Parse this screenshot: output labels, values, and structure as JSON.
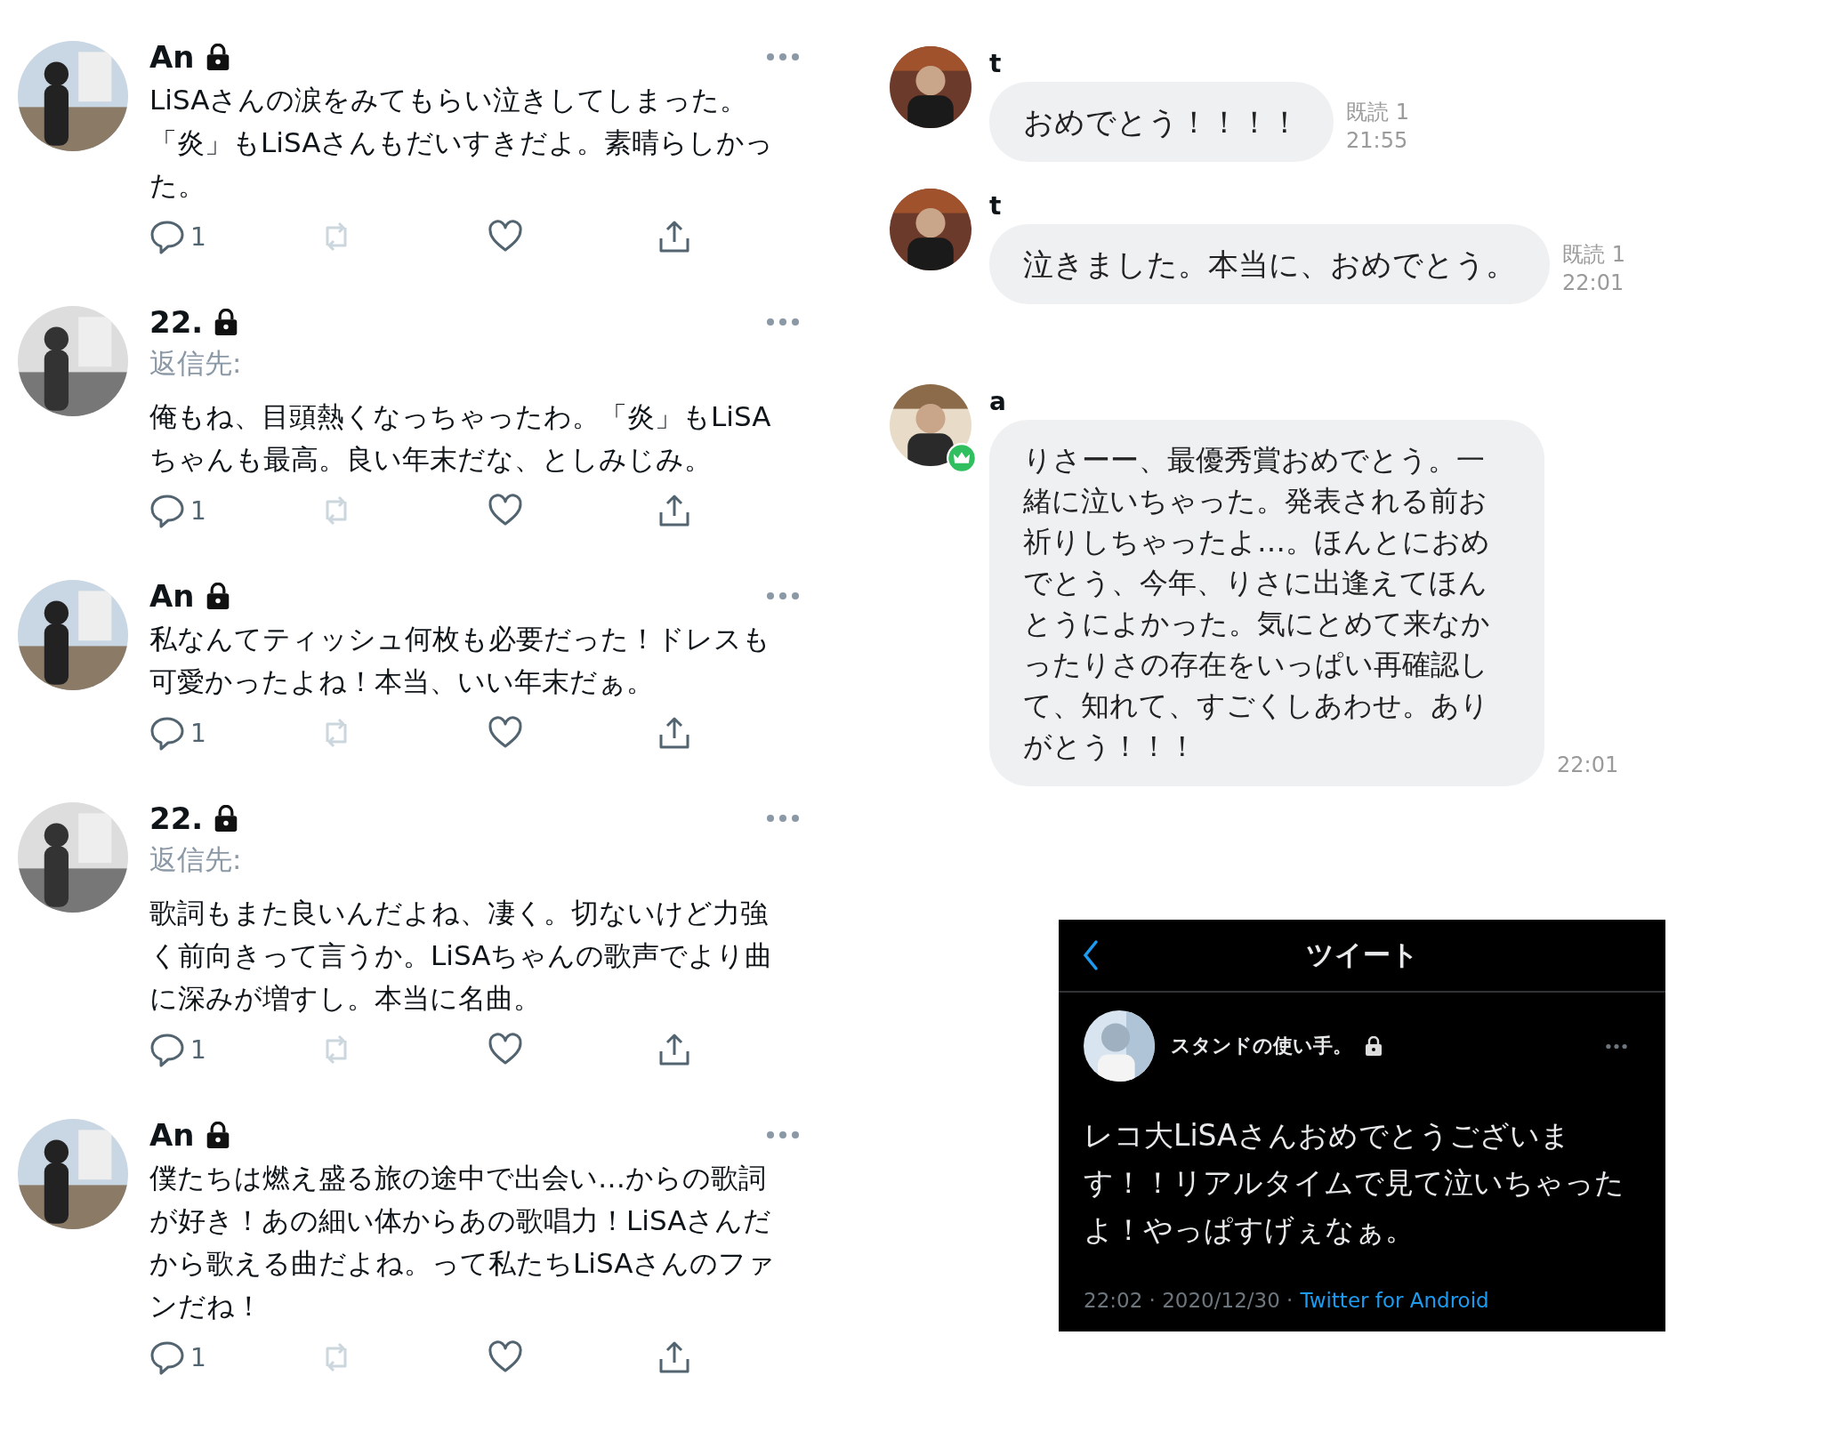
{
  "tweets": [
    {
      "name": "An",
      "protected": true,
      "text": "LiSAさんの涙をみてもらい泣きしてしまった。「炎」もLiSAさんもだいすきだよ。素晴らしかった。",
      "reply_count": "1"
    },
    {
      "name": "22.",
      "protected": true,
      "reply_to_label": "返信先:",
      "text": "俺もね、目頭熱くなっちゃったわ。「炎」もLiSAちゃんも最高。良い年末だな、としみじみ。",
      "reply_count": "1"
    },
    {
      "name": "An",
      "protected": true,
      "text": "私なんてティッシュ何枚も必要だった！ドレスも可愛かったよね！本当、いい年末だぁ。",
      "reply_count": "1"
    },
    {
      "name": "22.",
      "protected": true,
      "reply_to_label": "返信先:",
      "text": "歌詞もまた良いんだよね、凄く。切ないけど力強く前向きって言うか。LiSAちゃんの歌声でより曲に深みが増すし。本当に名曲。",
      "reply_count": "1"
    },
    {
      "name": "An",
      "protected": true,
      "text": "僕たちは燃え盛る旅の途中で出会い…からの歌詞が好き！あの細い体からあの歌唱力！LiSAさんだから歌える曲だよね。って私たちLiSAさんのファンだね！",
      "reply_count": "1"
    }
  ],
  "chat": [
    {
      "sender": "t",
      "text": "おめでとう！！！！",
      "read_label": "既読 1",
      "time": "21:55",
      "crown_badge": false
    },
    {
      "sender": "t",
      "text": "泣きました。本当に、おめでとう。",
      "read_label": "既読 1",
      "time": "22:01",
      "crown_badge": false
    },
    {
      "sender": "a",
      "text": "りさーー、最優秀賞おめでとう。一緒に泣いちゃった。発表される前お祈りしちゃったよ…。ほんとにおめでとう、今年、りさに出逢えてほんとうによかった。気にとめて来なかったりさの存在をいっぱい再確認して、知れて、すごくしあわせ。ありがとう！！！",
      "time": "22:01",
      "crown_badge": true
    }
  ],
  "tweet_card": {
    "header_title": "ツイート",
    "author": "スタンドの使い手。",
    "protected": true,
    "text": "レコ大LiSAさんおめでとうございます！！リアルタイムで見て泣いちゃったよ！やっぱすげぇなぁ。",
    "timestamp": "22:02 · 2020/12/30 ·",
    "source": "Twitter for Android"
  }
}
